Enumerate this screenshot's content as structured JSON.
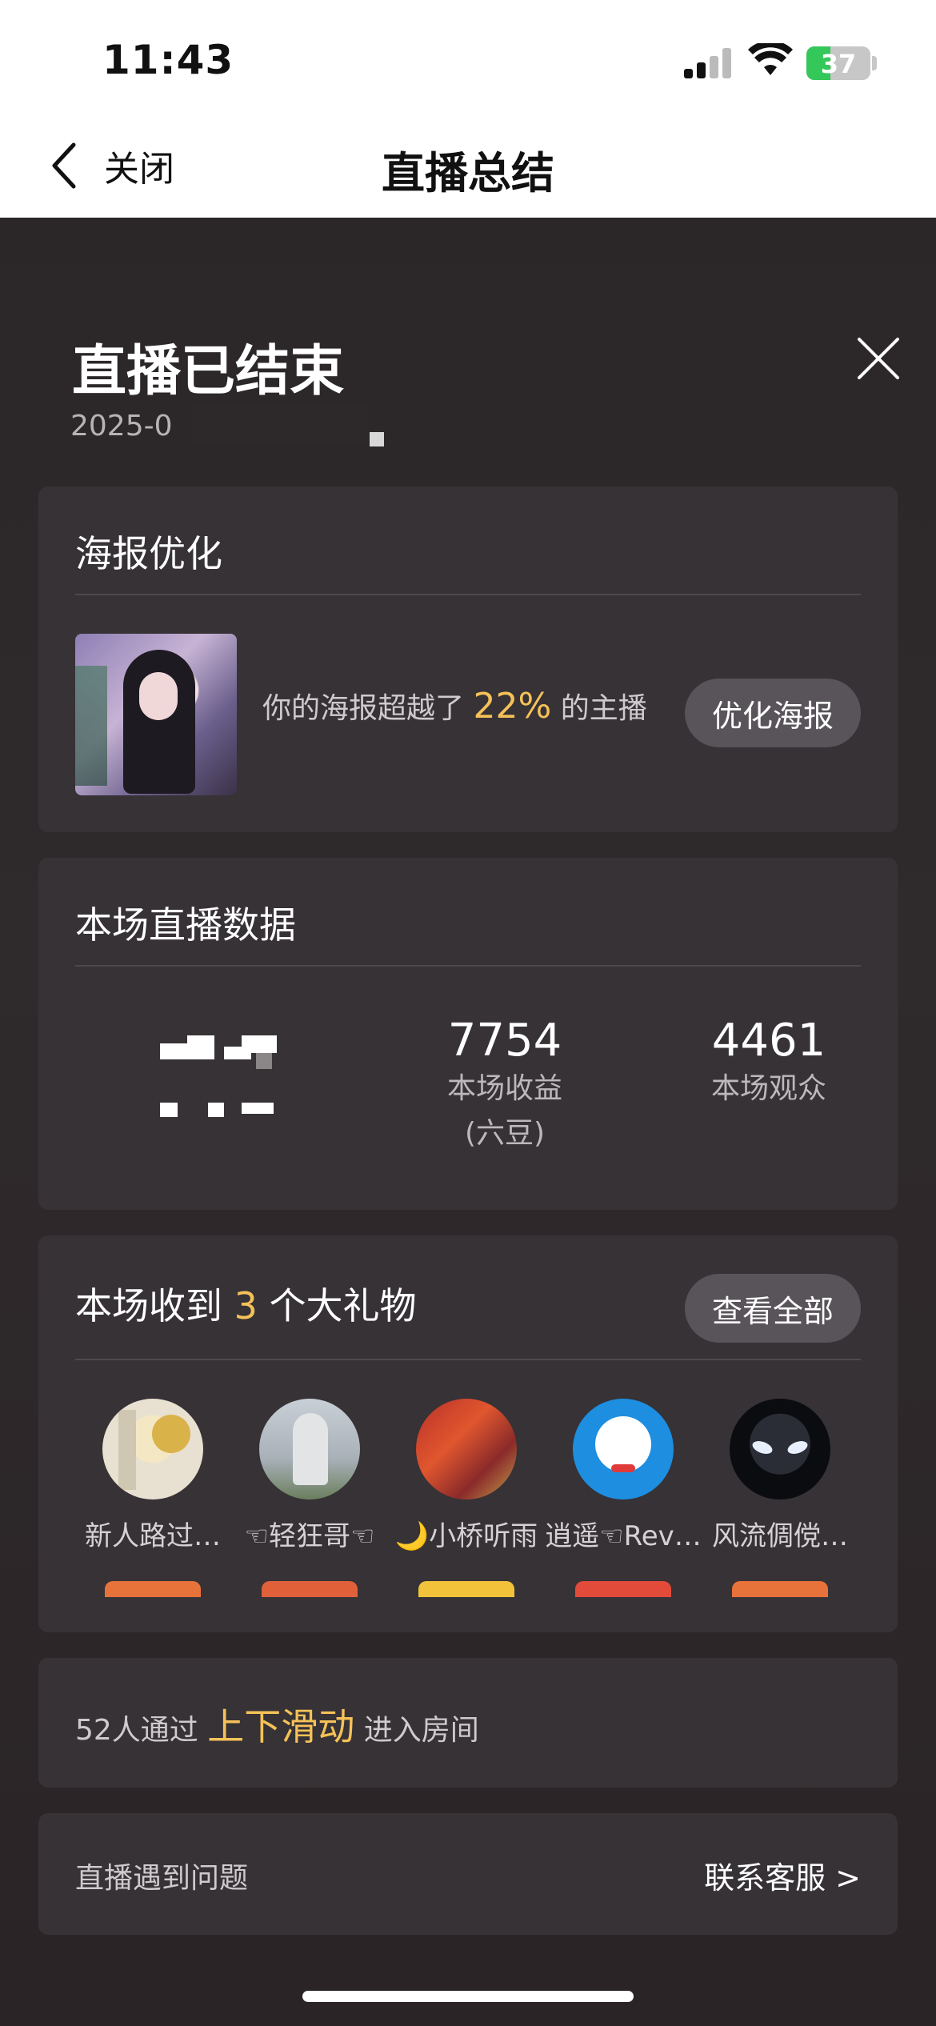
{
  "status_bar": {
    "time": "11:43",
    "battery": "37",
    "battery_level": 0.37
  },
  "nav": {
    "back_label": "关闭",
    "title": "直播总结"
  },
  "header": {
    "title": "直播已结束",
    "date": "2025-0"
  },
  "poster": {
    "title": "海报优化",
    "text_prefix": "你的海报超越了",
    "percent": "22%",
    "text_suffix": "的主播",
    "button": "优化海报"
  },
  "live_data": {
    "title": "本场直播数据",
    "stats": [
      {
        "value": "7754",
        "label": "本场收益",
        "sublabel": "(六豆)"
      },
      {
        "value": "4461",
        "label": "本场观众"
      }
    ]
  },
  "gifts": {
    "title_prefix": "本场收到",
    "count": "3",
    "title_suffix": "个大礼物",
    "view_all": "查看全部",
    "gifters": [
      {
        "name": "新人路过…",
        "badge_color": "#e8733a"
      },
      {
        "name": "☜轻狂哥☜",
        "badge_color": "#e0603a"
      },
      {
        "name": "🌙小桥听雨",
        "badge_color": "#f2c23a"
      },
      {
        "name": "逍遥☜Rev…",
        "badge_color": "#e24a3a"
      },
      {
        "name": "风流倜傥…",
        "badge_color": "#e8733a"
      }
    ]
  },
  "swipe": {
    "prefix": "52人通过",
    "highlight": "上下滑动",
    "suffix": "进入房间"
  },
  "help": {
    "label": "直播遇到问题",
    "contact": "联系客服 >"
  }
}
